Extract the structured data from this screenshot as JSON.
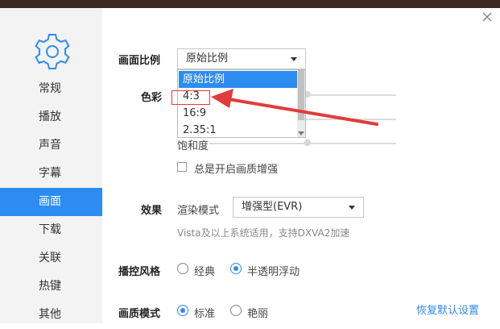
{
  "sidebar": {
    "items": [
      {
        "label": "常规"
      },
      {
        "label": "播放"
      },
      {
        "label": "声音"
      },
      {
        "label": "字幕"
      },
      {
        "label": "画面"
      },
      {
        "label": "下载"
      },
      {
        "label": "关联"
      },
      {
        "label": "热键"
      },
      {
        "label": "其他"
      }
    ],
    "active_index": 4
  },
  "picture_ratio": {
    "label": "画面比例",
    "value": "原始比例",
    "options": [
      "原始比例",
      "4:3",
      "16:9",
      "2.35:1"
    ],
    "selected_option": "原始比例"
  },
  "color": {
    "label": "色彩",
    "saturation_label": "饱和度"
  },
  "enhance": {
    "checkbox_label": "总是开启画质增强",
    "checked": false
  },
  "effect": {
    "label": "效果",
    "render_mode_label": "渲染模式",
    "render_mode_value": "增强型(EVR)",
    "note": "Vista及以上系统适用，支持DXVA2加速"
  },
  "control_style": {
    "label": "播控风格",
    "options": [
      "经典",
      "半透明浮动"
    ],
    "selected": "半透明浮动"
  },
  "quality_mode": {
    "label": "画质模式",
    "options": [
      "标准",
      "艳丽"
    ],
    "selected": "标准"
  },
  "restore_defaults": "恢复默认设置",
  "colors": {
    "accent": "#2d8cf0",
    "annotation": "#e23b3b",
    "sidebar_bg": "#f3f3f3"
  }
}
